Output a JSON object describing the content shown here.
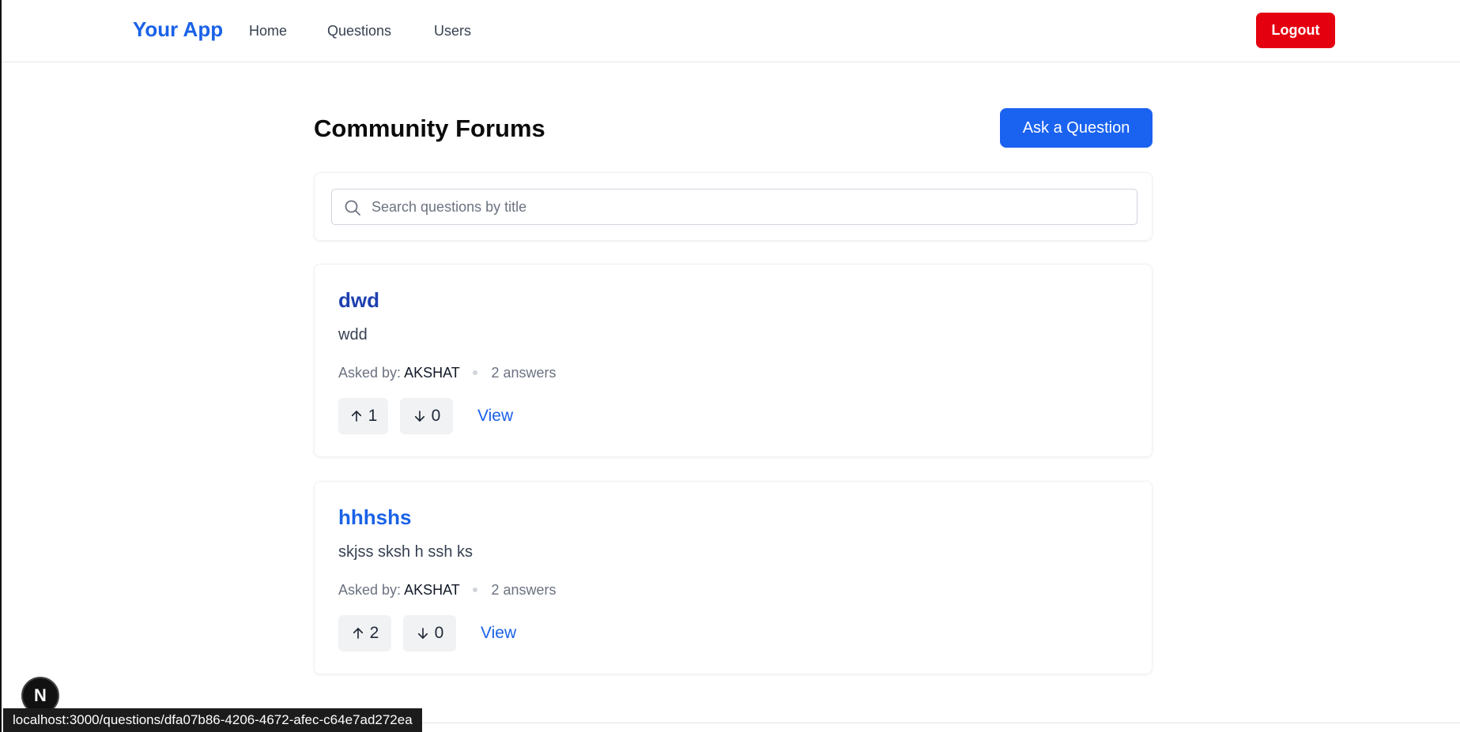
{
  "nav": {
    "brand": "Your App",
    "links": [
      "Home",
      "Questions",
      "Users"
    ],
    "logout": "Logout"
  },
  "page": {
    "title": "Community Forums",
    "ask_button": "Ask a Question"
  },
  "search": {
    "placeholder": "Search questions by title",
    "value": ""
  },
  "questions": [
    {
      "title": "dwd",
      "title_color": "#1e40af",
      "body": "wdd",
      "asked_by_label": "Asked by:",
      "author": "AKSHAT",
      "answers": "2 answers",
      "upvotes": "1",
      "downvotes": "0",
      "view": "View"
    },
    {
      "title": "hhhshs",
      "title_color": "#1a62e8",
      "body": "skjss sksh h ssh ks",
      "asked_by_label": "Asked by:",
      "author": "AKSHAT",
      "answers": "2 answers",
      "upvotes": "2",
      "downvotes": "0",
      "view": "View"
    }
  ],
  "status_bar": {
    "url": "localhost:3000/questions/dfa07b86-4206-4672-afec-c64e7ad272ea"
  },
  "dev_badge": {
    "letter": "N",
    "icon": "nextjs-icon"
  },
  "colors": {
    "brand": "#1a62e8",
    "primary_button": "#1a62f0",
    "logout": "#e5000f"
  }
}
